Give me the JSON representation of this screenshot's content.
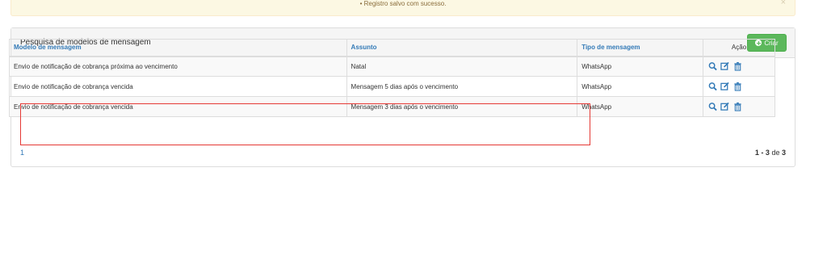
{
  "alert": {
    "message": "Registro salvo com sucesso.",
    "close": "×"
  },
  "panel": {
    "title": "Pesquisa de modelos de mensagem",
    "create_label": "Criar"
  },
  "table": {
    "headers": [
      "Modelo de mensagem",
      "Assunto",
      "Tipo de mensagem",
      "Ação"
    ],
    "rows": [
      {
        "modelo": "Envio de notificação de cobrança próxima ao vencimento",
        "assunto": "Natal",
        "tipo": "WhatsApp"
      },
      {
        "modelo": "Envio de notificação de cobrança vencida",
        "assunto": "Mensagem 5 dias após o vencimento",
        "tipo": "WhatsApp"
      },
      {
        "modelo": "Envio de notificação de cobrança vencida",
        "assunto": "Mensagem 3 dias após o vencimento",
        "tipo": "WhatsApp"
      }
    ],
    "action_icons": [
      "search-icon",
      "edit-icon",
      "trash-icon"
    ]
  },
  "pagination": {
    "page": "1",
    "range": "1 - 3",
    "of_label": "de",
    "total": "3"
  },
  "colors": {
    "link": "#337ab7",
    "success": "#5cb85c",
    "highlight": "#e53935",
    "alert_bg": "#fcf8e3"
  }
}
